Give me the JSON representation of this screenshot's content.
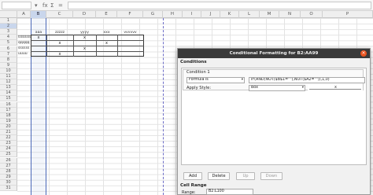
{
  "formula_bar": {
    "function_wizard_icon": "fx",
    "sum_icon": "Σ",
    "equals_icon": "="
  },
  "columns": [
    "A",
    "B",
    "C",
    "D",
    "E",
    "F",
    "G",
    "H",
    "I",
    "J",
    "K",
    "L",
    "M",
    "N",
    "O",
    "P"
  ],
  "selected_column": "B",
  "rows": [
    "1",
    "2",
    "3",
    "4",
    "5",
    "6",
    "7",
    "8",
    "9",
    "10",
    "11",
    "12",
    "13",
    "14",
    "15",
    "16",
    "17",
    "18",
    "19",
    "20",
    "21",
    "22",
    "23",
    "24",
    "25",
    "26",
    "27",
    "28",
    "29",
    "30",
    "31"
  ],
  "selected_row": "2",
  "sheet": {
    "headers": [
      "aaa",
      "zzzzz",
      "yyyy",
      "xxx",
      "vvvvvv"
    ],
    "row_labels": [
      "ttttttttt",
      "qqqqq",
      "ssssss",
      "uuuu"
    ],
    "marks": [
      {
        "row": 0,
        "col": 0,
        "text": "x"
      },
      {
        "row": 0,
        "col": 2,
        "text": "x"
      },
      {
        "row": 1,
        "col": 1,
        "text": "x"
      },
      {
        "row": 1,
        "col": 3,
        "text": "x"
      },
      {
        "row": 2,
        "col": 2,
        "text": "x"
      },
      {
        "row": 3,
        "col": 1,
        "text": "x"
      }
    ]
  },
  "dialog": {
    "title": "Conditional Formatting for B2:AA99",
    "close_icon": "×",
    "conditions_label": "Conditions",
    "condition_label": "Condition 1",
    "condition_type": "Formula is",
    "formula": "IF(AND(NOT($B$1=\"\"),NOT($A2=\"\")),1,0)",
    "apply_style_label": "Apply Style:",
    "style_value": "Box",
    "preview_mark": "x",
    "buttons": {
      "add": "Add",
      "delete": "Delete",
      "up": "Up",
      "down": "Down"
    },
    "cell_range_label": "Cell Range",
    "range_label": "Range:",
    "range_value": "B2:L100"
  }
}
